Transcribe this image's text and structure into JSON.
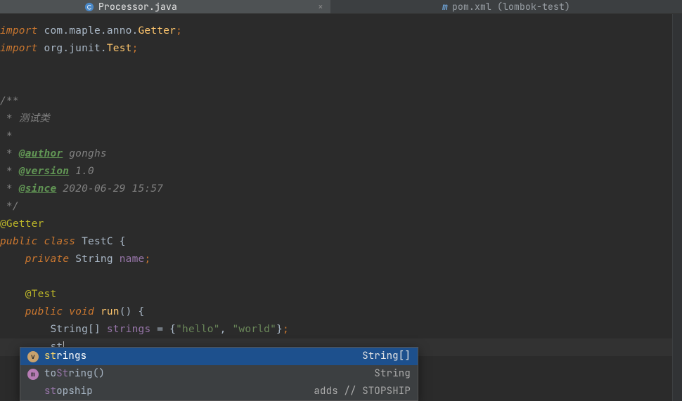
{
  "tabs": {
    "active": {
      "file": "Processor.java",
      "icon": "java-class"
    },
    "other": {
      "file": "pom.xml (lombok-test)",
      "icon": "maven"
    }
  },
  "code": {
    "import1": {
      "kw": "import",
      "pkg": "com.maple.anno.",
      "cls": "Getter"
    },
    "import2": {
      "kw": "import",
      "pkg": "org.junit.",
      "cls": "Test"
    },
    "doc": {
      "open": "/**",
      "l1": " * 测试类",
      "l2": " *",
      "author_tag": "@author",
      "author_val": "gonghs",
      "version_tag": "@version",
      "version_val": "1.0",
      "since_tag": "@since",
      "since_val": "2020-06-29 15:57",
      "close": " */"
    },
    "anno1": "@Getter",
    "decl": {
      "mods": "public",
      "kw": "class",
      "name": "TestC"
    },
    "field": {
      "mods": "private",
      "type": "String",
      "name": "name"
    },
    "anno2": "@Test",
    "method": {
      "mods": "public",
      "ret": "void",
      "name": "run"
    },
    "arr": {
      "type": "String",
      "brk": "[]",
      "name": "strings",
      "v1": "\"hello\"",
      "v2": "\"world\""
    },
    "typing": "st"
  },
  "completion": {
    "items": [
      {
        "kind": "var",
        "name_pre": "st",
        "name_rest": "rings",
        "type": "String[]"
      },
      {
        "kind": "mth",
        "name_pre": "to",
        "name_hl": "St",
        "name_rest": "ring",
        "paren": "()",
        "type": "String"
      },
      {
        "kind": "",
        "name_pre": "st",
        "name_rest": "opship",
        "type": "adds // STOPSHIP"
      }
    ]
  }
}
